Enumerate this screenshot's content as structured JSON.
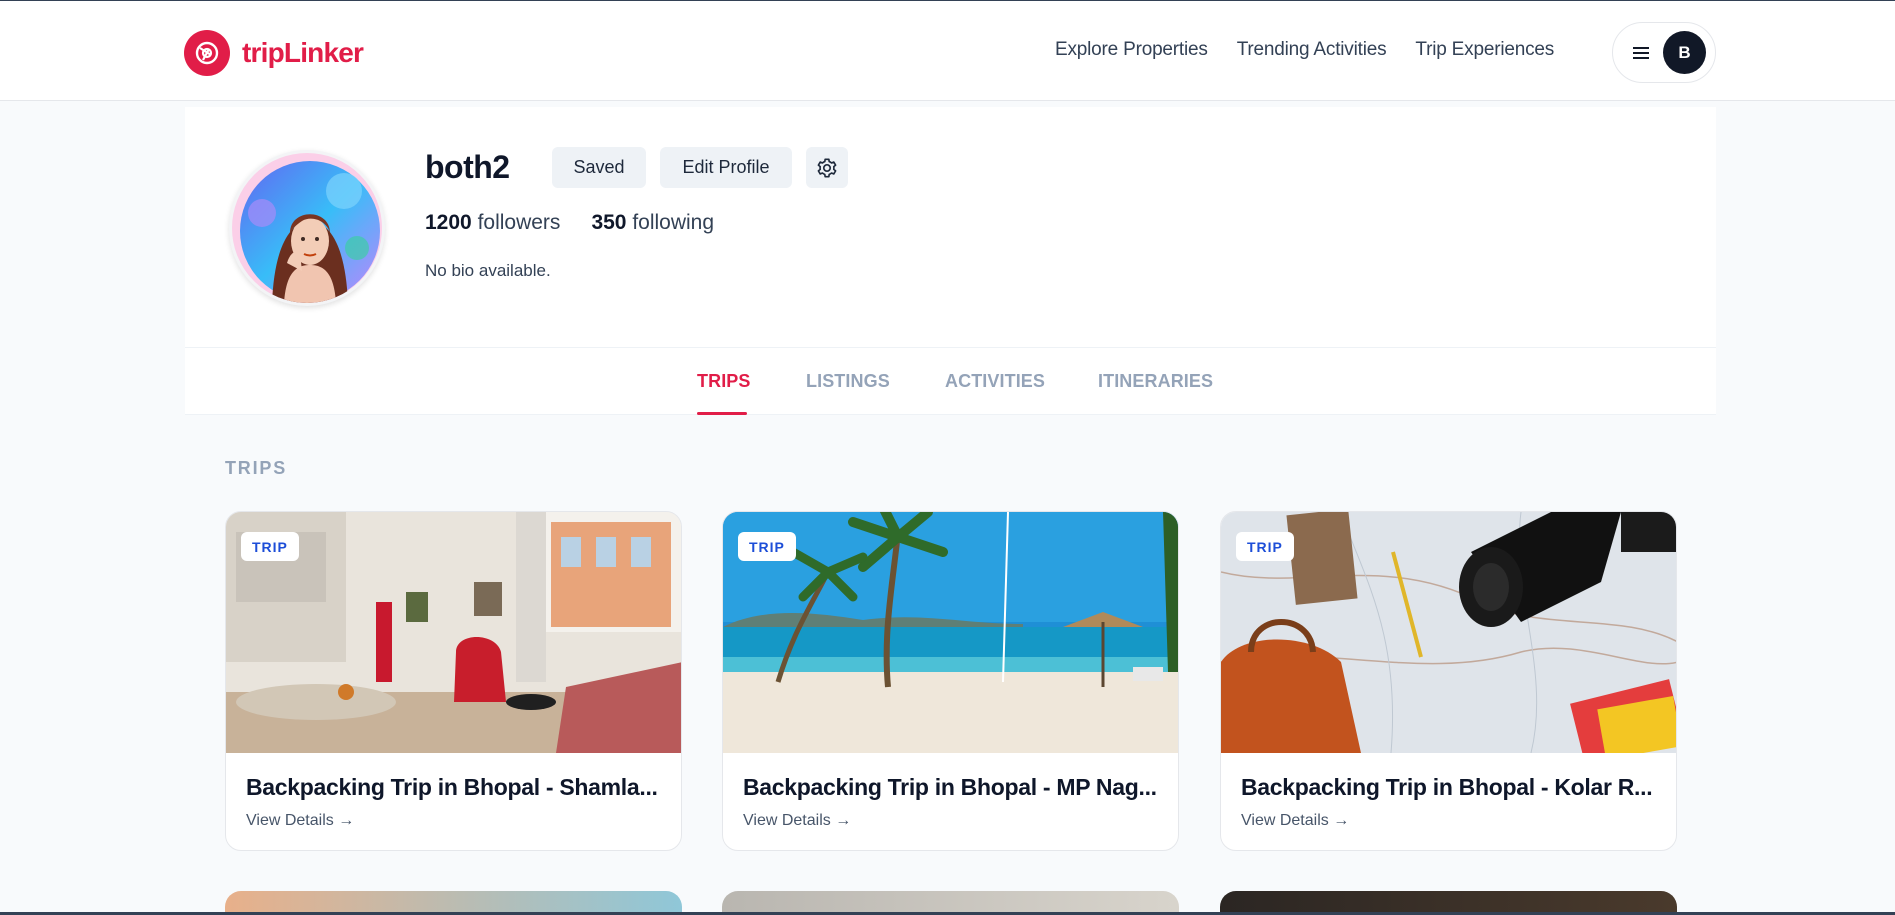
{
  "app": {
    "brand": "tripLinker",
    "brand_color": "#e11d48"
  },
  "nav": {
    "links": [
      "Explore Properties",
      "Trending Activities",
      "Trip Experiences"
    ],
    "menu_icon": "hamburger-icon",
    "user_initial": "B"
  },
  "profile": {
    "username": "both2",
    "saved_label": "Saved",
    "edit_label": "Edit Profile",
    "settings_icon": "gear-icon",
    "followers_count": "1200",
    "followers_label": "followers",
    "following_count": "350",
    "following_label": "following",
    "bio": "No bio available."
  },
  "tabs": {
    "items": [
      "TRIPS",
      "LISTINGS",
      "ACTIVITIES",
      "ITINERARIES"
    ],
    "active": "TRIPS"
  },
  "section": {
    "label": "TRIPS"
  },
  "cards": [
    {
      "badge": "TRIP",
      "title": "Backpacking Trip in Bhopal - Shamla...",
      "link": "View Details →"
    },
    {
      "badge": "TRIP",
      "title": "Backpacking Trip in Bhopal - MP Nag...",
      "link": "View Details →"
    },
    {
      "badge": "TRIP",
      "title": "Backpacking Trip in Bhopal - Kolar R...",
      "link": "View Details →"
    }
  ]
}
